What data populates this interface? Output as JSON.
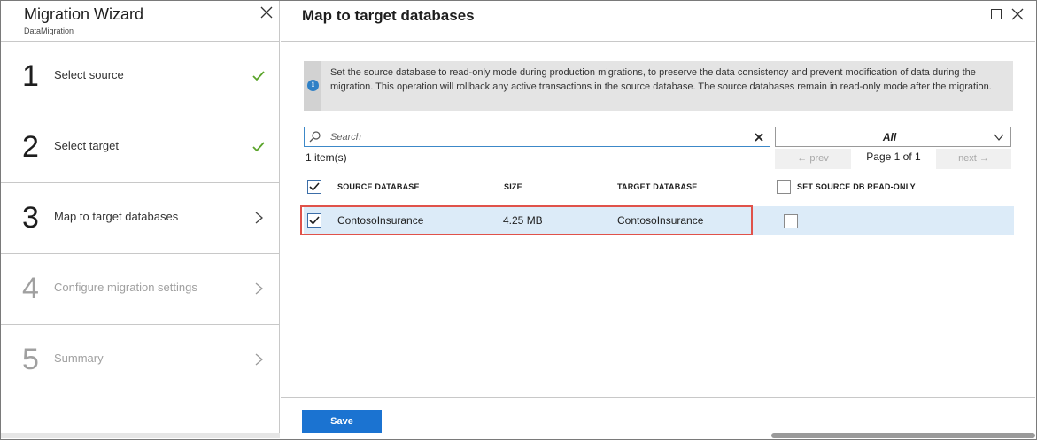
{
  "wizard": {
    "title": "Migration Wizard",
    "subtitle": "DataMigration",
    "steps": [
      {
        "number": "1",
        "label": "Select source",
        "state": "complete"
      },
      {
        "number": "2",
        "label": "Select target",
        "state": "complete"
      },
      {
        "number": "3",
        "label": "Map to target databases",
        "state": "active"
      },
      {
        "number": "4",
        "label": "Configure migration settings",
        "state": "disabled"
      },
      {
        "number": "5",
        "label": "Summary",
        "state": "disabled"
      }
    ]
  },
  "main": {
    "title": "Map to target databases",
    "info_text": "Set the source database to read-only mode during production migrations, to preserve the data consistency and prevent modification of data during the migration. This operation will rollback any active transactions in the source database. The source databases remain in read-only mode after the migration.",
    "search": {
      "placeholder": "Search",
      "value": ""
    },
    "filter": {
      "selected": "All"
    },
    "item_count": "1 item(s)",
    "pager": {
      "prev": "← prev",
      "info": "Page 1 of 1",
      "next": "next →"
    },
    "table": {
      "headers": {
        "source": "SOURCE DATABASE",
        "size": "SIZE",
        "target": "TARGET DATABASE",
        "readonly": "SET SOURCE DB READ-ONLY"
      },
      "rows": [
        {
          "selected": true,
          "source": "ContosoInsurance",
          "size": "4.25 MB",
          "target": "ContosoInsurance",
          "readonly": false
        }
      ]
    },
    "save_label": "Save"
  },
  "colors": {
    "accent": "#1b73d1",
    "check": "#5aa42a",
    "selected_row": "#dcebf8",
    "highlight": "#e0524a",
    "info_bg": "#e4e4e4"
  }
}
